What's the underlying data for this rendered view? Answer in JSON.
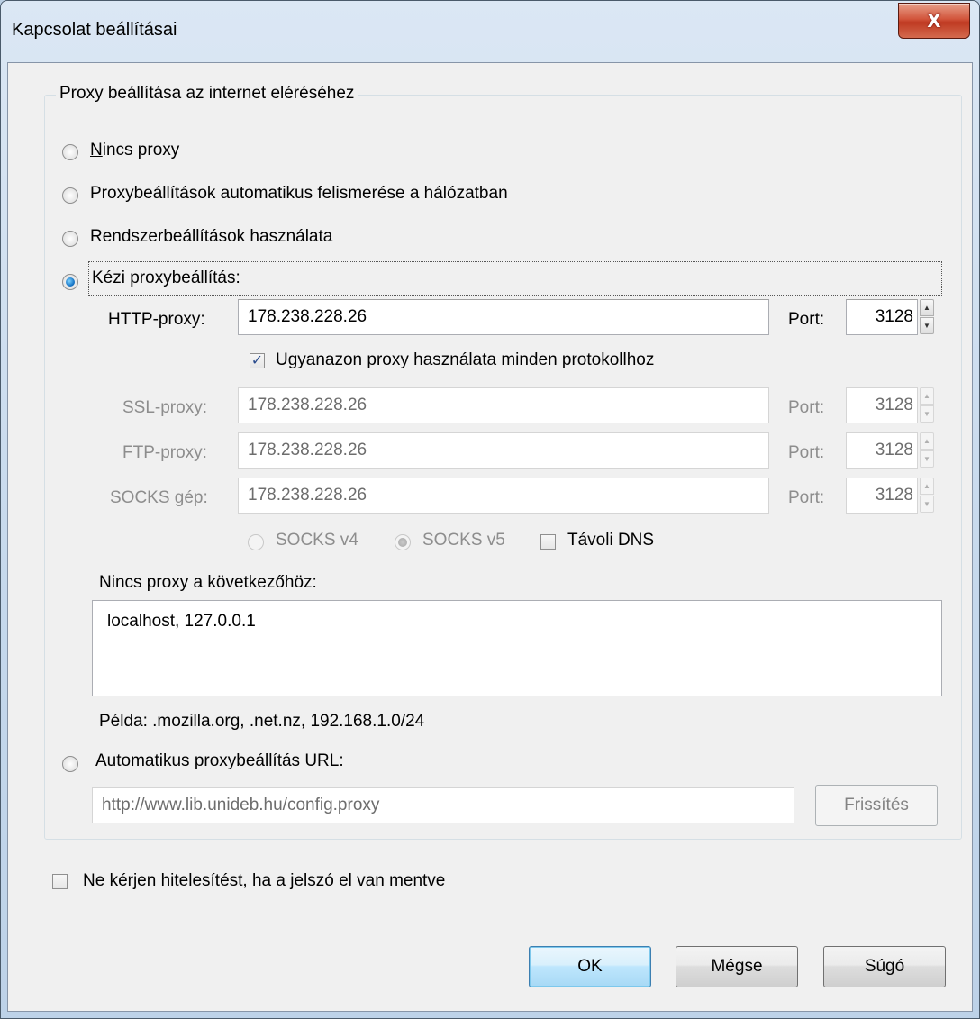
{
  "window": {
    "title": "Kapcsolat beállításai",
    "close_label": "X"
  },
  "proxy_group": {
    "legend": "Proxy beállítása az internet eléréséhez",
    "options": [
      {
        "label": "Nincs proxy",
        "checked": false
      },
      {
        "label": "Proxybeállítások automatikus felismerése a hálózatban",
        "checked": false
      },
      {
        "label": "Rendszerbeállítások használata",
        "checked": false
      },
      {
        "label": "Kézi proxybeállítás:",
        "checked": true
      }
    ],
    "manual": {
      "http": {
        "label": "HTTP-proxy:",
        "value": "178.238.228.26",
        "port_label": "Port:",
        "port": "3128"
      },
      "same_proxy": {
        "label": "Ugyanazon proxy használata minden protokollhoz",
        "checked": true
      },
      "ssl": {
        "label": "SSL-proxy:",
        "value": "178.238.228.26",
        "port_label": "Port:",
        "port": "3128"
      },
      "ftp": {
        "label": "FTP-proxy:",
        "value": "178.238.228.26",
        "port_label": "Port:",
        "port": "3128"
      },
      "socks": {
        "label": "SOCKS gép:",
        "value": "178.238.228.26",
        "port_label": "Port:",
        "port": "3128"
      },
      "socks_v4": {
        "label": "SOCKS v4",
        "checked": false
      },
      "socks_v5": {
        "label": "SOCKS v5",
        "checked": true
      },
      "remote_dns": {
        "label": "Távoli DNS",
        "checked": false
      }
    },
    "no_proxy": {
      "label": "Nincs proxy a következőhöz:",
      "value": "localhost, 127.0.0.1",
      "example": "Példa: .mozilla.org, .net.nz, 192.168.1.0/24"
    },
    "auto_url": {
      "label": "Automatikus proxybeállítás URL:",
      "checked": false,
      "value": "http://www.lib.unideb.hu/config.proxy",
      "reload_label": "Frissítés"
    }
  },
  "no_auth_prompt": {
    "label": "Ne kérjen hitelesítést, ha a jelszó el van mentve",
    "checked": false
  },
  "buttons": {
    "ok": "OK",
    "cancel": "Mégse",
    "help": "Súgó"
  }
}
